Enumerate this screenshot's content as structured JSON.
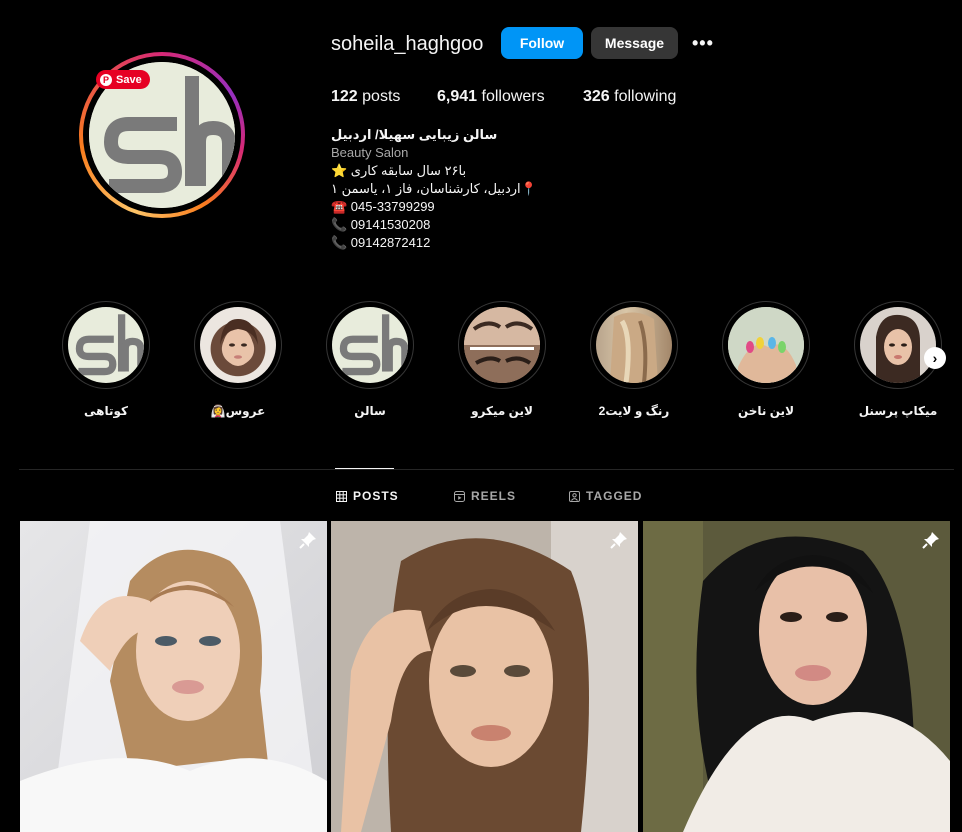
{
  "profile": {
    "username": "soheila_haghgoo",
    "follow_label": "Follow",
    "message_label": "Message",
    "more_label": "•••",
    "save_badge": "Save",
    "avatar_logo": "sh"
  },
  "stats": {
    "posts_count": "122",
    "posts_label": "posts",
    "followers_count": "6,941",
    "followers_label": "followers",
    "following_count": "326",
    "following_label": "following"
  },
  "bio": {
    "name": "سالن زیبایی سهیلا/ اردبیل",
    "category": "Beauty Salon",
    "lines": [
      "با۲۶ سال سابقه کاری ⭐",
      "📍اردبیل، کارشناسان، فاز ۱، یاسمن ۱",
      "☎️ 045-33799299",
      "📞 09141530208",
      "📞 09142872412"
    ]
  },
  "highlights": [
    {
      "label": "کوتاهی",
      "icon": "sh-logo"
    },
    {
      "label": "👰‍♀️عروس",
      "icon": "bride-photo"
    },
    {
      "label": "سالن",
      "icon": "sh-logo"
    },
    {
      "label": "لاین میکرو",
      "icon": "brows-photo"
    },
    {
      "label": "رنگ و لایت2",
      "icon": "hair-color-photo"
    },
    {
      "label": "لاین ناخن",
      "icon": "nails-photo"
    },
    {
      "label": "میکاپ پرسنل",
      "icon": "makeup-photo"
    }
  ],
  "tabs": {
    "posts": "POSTS",
    "reels": "REELS",
    "tagged": "TAGGED"
  },
  "colors": {
    "follow_button": "#0095f6",
    "message_button": "#363636",
    "save_badge": "#e60023",
    "background": "#000000"
  }
}
